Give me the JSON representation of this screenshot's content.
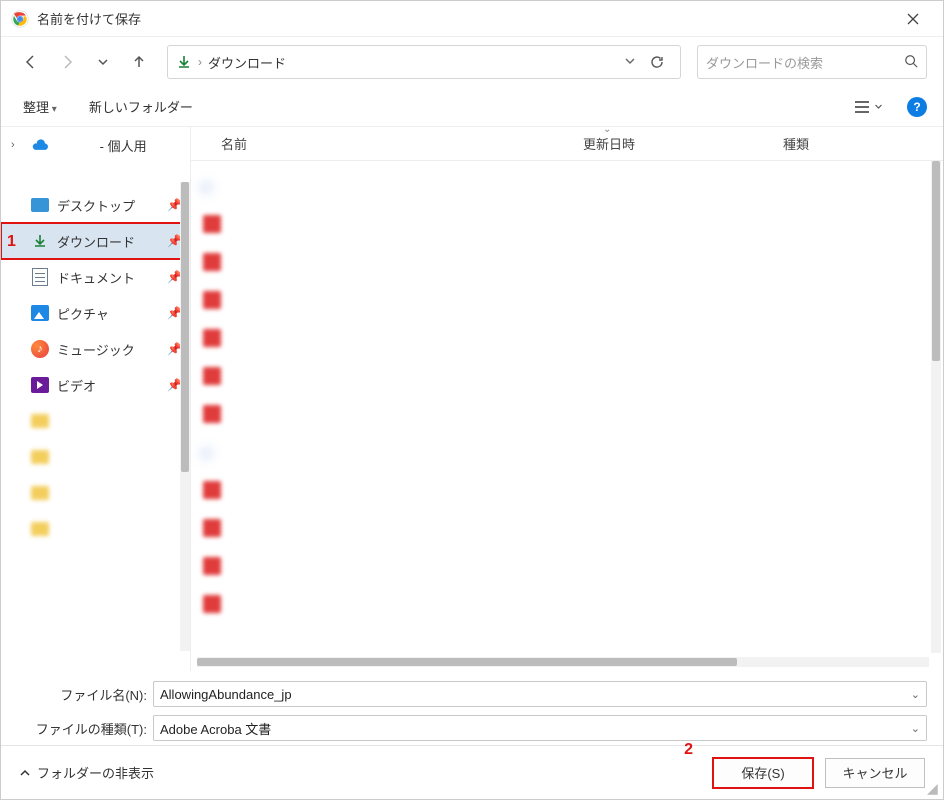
{
  "title": "名前を付けて保存",
  "address": {
    "location": "ダウンロード"
  },
  "search": {
    "placeholder": "ダウンロードの検索"
  },
  "commands": {
    "organize": "整理",
    "new_folder": "新しいフォルダー"
  },
  "columns": {
    "name": "名前",
    "modified": "更新日時",
    "type": "種類"
  },
  "sidebar": {
    "personal_suffix": " - 個人用",
    "personal_blur": "　　　",
    "quick": [
      {
        "label": "デスクトップ",
        "icon": "desktop"
      },
      {
        "label": "ダウンロード",
        "icon": "download",
        "selected": true
      },
      {
        "label": "ドキュメント",
        "icon": "document"
      },
      {
        "label": "ピクチャ",
        "icon": "picture"
      },
      {
        "label": "ミュージック",
        "icon": "music"
      },
      {
        "label": "ビデオ",
        "icon": "video"
      }
    ]
  },
  "inputs": {
    "filename_label": "ファイル名(N):",
    "filename_value": "AllowingAbundance_jp",
    "filetype_label": "ファイルの種類(T):",
    "filetype_value": "Adobe Acroba 文書"
  },
  "footer": {
    "hide_folders": "フォルダーの非表示",
    "save": "保存(S)",
    "cancel": "キャンセル"
  },
  "annotations": {
    "one": "1",
    "two": "2"
  }
}
